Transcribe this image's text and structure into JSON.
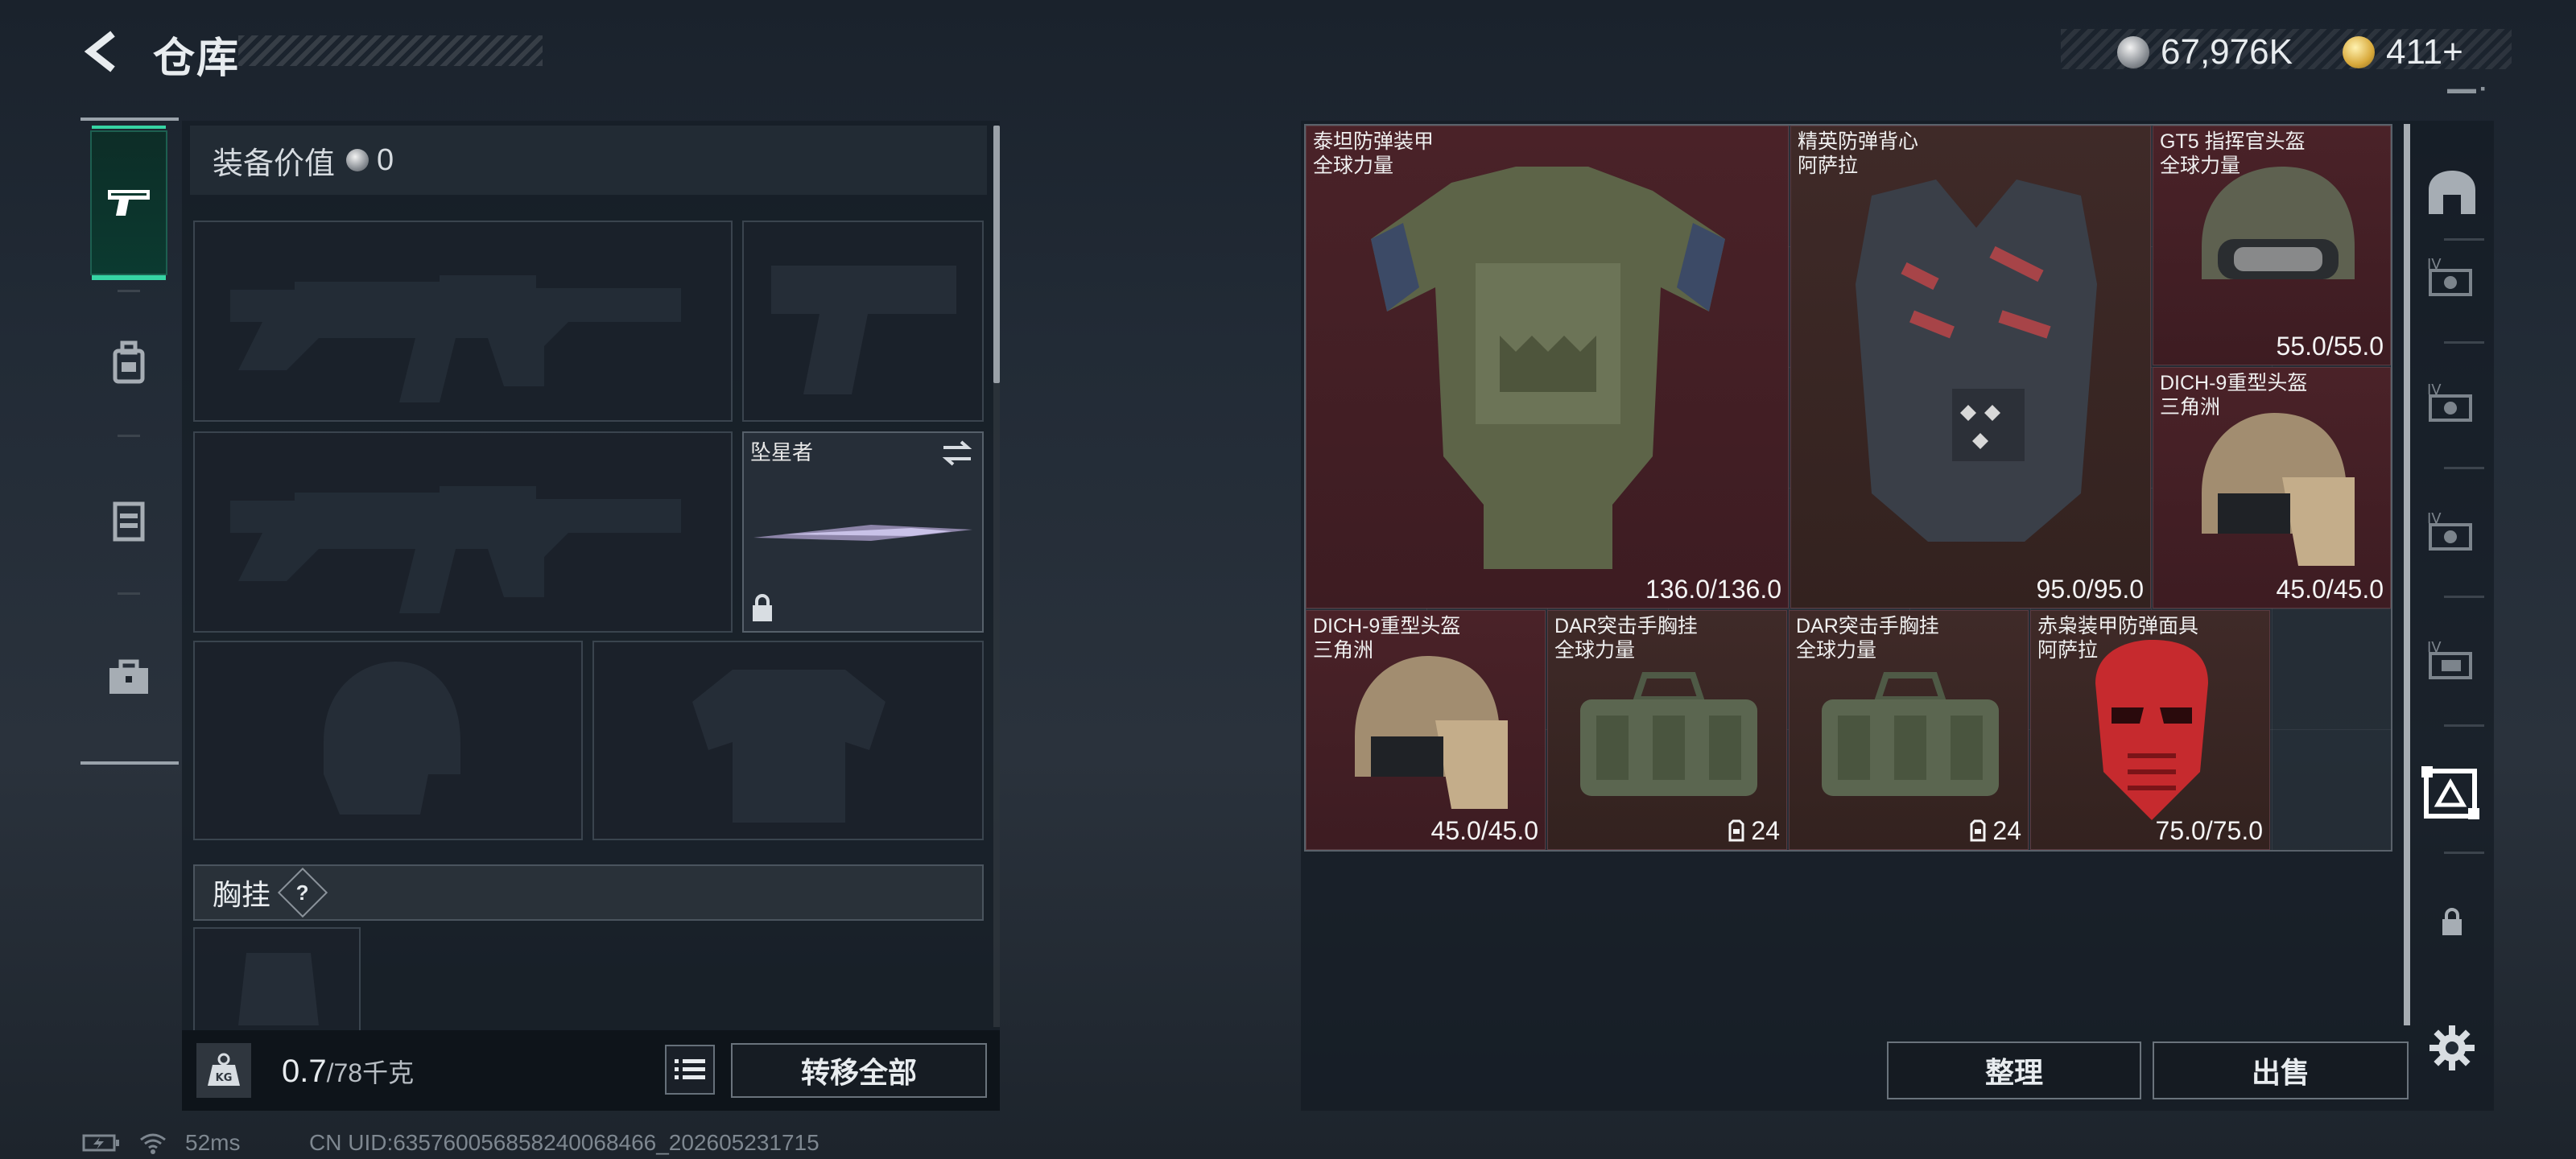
{
  "header": {
    "title": "仓库",
    "currency_silver": "67,976K",
    "currency_gold": "411+"
  },
  "tabs": [
    {
      "name": "weapons",
      "icon": "pistol-icon",
      "active": true
    },
    {
      "name": "backpack",
      "icon": "backpack-icon",
      "active": false
    },
    {
      "name": "vest",
      "icon": "vest-icon",
      "active": false
    },
    {
      "name": "toolbox",
      "icon": "briefcase-icon",
      "active": false
    }
  ],
  "equipment": {
    "value_label": "装备价值",
    "value": "0",
    "melee_name": "坠星者",
    "chest_rig_label": "胸挂",
    "help": "?",
    "weight_current": "0.7",
    "weight_max": "/78千克",
    "transfer_all": "转移全部"
  },
  "stash": {
    "items": [
      {
        "name": "泰坦防弹装甲",
        "sub": "全球力量",
        "value": "136.0/136.0"
      },
      {
        "name": "精英防弹背心",
        "sub": "阿萨拉",
        "value": "95.0/95.0"
      },
      {
        "name": "GT5 指挥官头盔",
        "sub": "全球力量",
        "value": "55.0/55.0"
      },
      {
        "name": "DICH-9重型头盔",
        "sub": "三角洲",
        "value": "45.0/45.0"
      },
      {
        "name": "DICH-9重型头盔",
        "sub": "三角洲",
        "value": "45.0/45.0"
      },
      {
        "name": "DAR突击手胸挂",
        "sub": "全球力量",
        "value": "24"
      },
      {
        "name": "DAR突击手胸挂",
        "sub": "全球力量",
        "value": "24"
      },
      {
        "name": "赤枭装甲防弹面具",
        "sub": "阿萨拉",
        "value": "75.0/75.0"
      }
    ],
    "sort_label": "整理",
    "sell_label": "出售"
  },
  "rail": {
    "lock_icon": "lock-icon",
    "settings_icon": "gear-icon"
  },
  "status": {
    "ping": "52ms",
    "uid": "CN UID:635760056858240068466_202605231715"
  },
  "colors": {
    "accent": "#36d4a4",
    "item_bg": "#4a2228"
  }
}
